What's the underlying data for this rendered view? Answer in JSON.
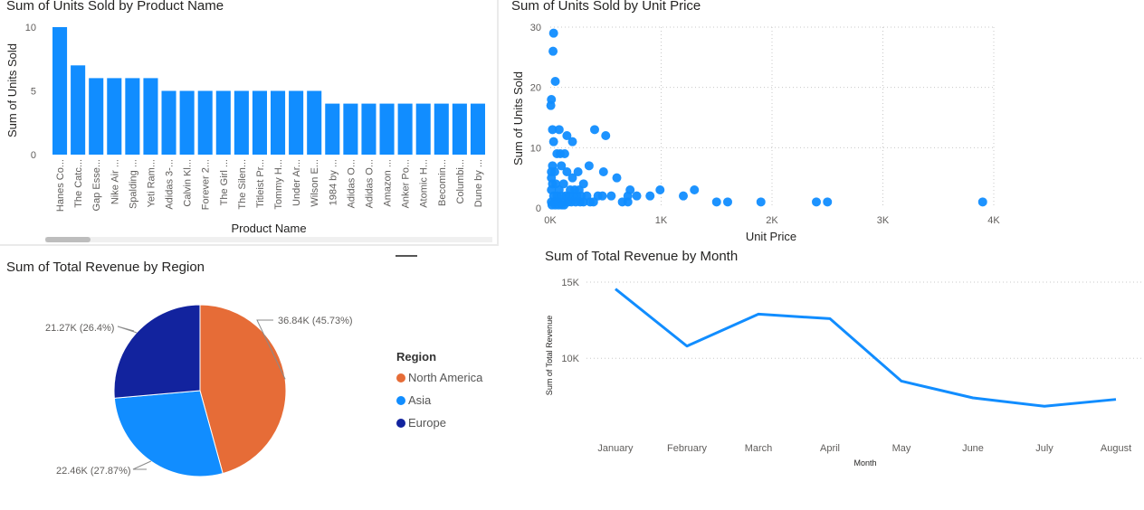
{
  "chart_data": [
    {
      "id": "bar",
      "type": "bar",
      "title": "Sum of Units Sold by Product Name",
      "xlabel": "Product Name",
      "ylabel": "Sum of Units Sold",
      "ylim": [
        0,
        10
      ],
      "yticks": [
        0,
        5,
        10
      ],
      "categories": [
        "Hanes Co...",
        "The Catc...",
        "Gap Esse...",
        "Nike Air ...",
        "Spalding ...",
        "Yeti Ram...",
        "Adidas 3-...",
        "Calvin Kl...",
        "Forever 2...",
        "The Girl ...",
        "The Silen...",
        "Titleist Pr...",
        "Tommy H...",
        "Under Ar...",
        "Wilson E...",
        "1984 by ...",
        "Adidas O...",
        "Adidas O...",
        "Amazon ...",
        "Anker Po...",
        "Atomic H...",
        "Becomin...",
        "Columbi...",
        "Dune by ..."
      ],
      "values": [
        10,
        7,
        6,
        6,
        6,
        6,
        5,
        5,
        5,
        5,
        5,
        5,
        5,
        5,
        5,
        4,
        4,
        4,
        4,
        4,
        4,
        4,
        4,
        4
      ],
      "color": "#118DFF"
    },
    {
      "id": "scatter",
      "type": "scatter",
      "title": "Sum of Units Sold by Unit Price",
      "xlabel": "Unit Price",
      "ylabel": "Sum of Units Sold",
      "xlim": [
        0,
        4000
      ],
      "ylim": [
        0,
        30
      ],
      "xticks": [
        {
          "v": 0,
          "label": "0K"
        },
        {
          "v": 1000,
          "label": "1K"
        },
        {
          "v": 2000,
          "label": "2K"
        },
        {
          "v": 3000,
          "label": "3K"
        },
        {
          "v": 4000,
          "label": "4K"
        }
      ],
      "yticks": [
        0,
        10,
        20,
        30
      ],
      "color": "#118DFF",
      "points": [
        [
          30,
          29
        ],
        [
          25,
          26
        ],
        [
          45,
          21
        ],
        [
          10,
          18
        ],
        [
          5,
          17
        ],
        [
          20,
          13
        ],
        [
          80,
          13
        ],
        [
          150,
          12
        ],
        [
          400,
          13
        ],
        [
          500,
          12
        ],
        [
          30,
          11
        ],
        [
          200,
          11
        ],
        [
          60,
          9
        ],
        [
          90,
          9
        ],
        [
          130,
          9
        ],
        [
          20,
          7
        ],
        [
          100,
          7
        ],
        [
          350,
          7
        ],
        [
          10,
          6
        ],
        [
          40,
          6
        ],
        [
          150,
          6
        ],
        [
          250,
          6
        ],
        [
          480,
          6
        ],
        [
          600,
          5
        ],
        [
          200,
          5
        ],
        [
          300,
          4
        ],
        [
          10,
          5
        ],
        [
          20,
          4
        ],
        [
          50,
          4
        ],
        [
          120,
          4
        ],
        [
          180,
          3
        ],
        [
          220,
          3
        ],
        [
          260,
          3
        ],
        [
          80,
          3
        ],
        [
          10,
          3
        ],
        [
          30,
          2
        ],
        [
          60,
          2
        ],
        [
          100,
          2
        ],
        [
          140,
          2
        ],
        [
          170,
          2
        ],
        [
          210,
          2
        ],
        [
          240,
          2
        ],
        [
          280,
          2
        ],
        [
          330,
          2
        ],
        [
          430,
          2
        ],
        [
          470,
          2
        ],
        [
          550,
          2
        ],
        [
          700,
          2
        ],
        [
          780,
          2
        ],
        [
          900,
          2
        ],
        [
          10,
          1
        ],
        [
          40,
          1
        ],
        [
          70,
          1
        ],
        [
          110,
          1
        ],
        [
          160,
          1
        ],
        [
          190,
          1
        ],
        [
          230,
          1
        ],
        [
          270,
          1
        ],
        [
          300,
          1
        ],
        [
          360,
          1
        ],
        [
          390,
          1
        ],
        [
          650,
          1
        ],
        [
          700,
          1
        ],
        [
          720,
          3
        ],
        [
          990,
          3
        ],
        [
          1300,
          3
        ],
        [
          1200,
          2
        ],
        [
          1500,
          1
        ],
        [
          1600,
          1
        ],
        [
          1900,
          1
        ],
        [
          2400,
          1
        ],
        [
          2500,
          1
        ],
        [
          3900,
          1
        ],
        [
          15,
          0.5
        ],
        [
          45,
          0.5
        ],
        [
          75,
          0.5
        ],
        [
          105,
          0.5
        ],
        [
          125,
          0.5
        ]
      ]
    },
    {
      "id": "pie",
      "type": "pie",
      "title": "Sum of Total Revenue by Region",
      "legend_title": "Region",
      "legend_position": "right",
      "slices": [
        {
          "name": "North America",
          "value": 36840,
          "percent": 45.73,
          "label": "36.84K (45.73%)",
          "color": "#E66C37"
        },
        {
          "name": "Asia",
          "value": 22460,
          "percent": 27.87,
          "label": "22.46K (27.87%)",
          "color": "#118DFF"
        },
        {
          "name": "Europe",
          "value": 21270,
          "percent": 26.4,
          "label": "21.27K (26.4%)",
          "color": "#12239E"
        }
      ]
    },
    {
      "id": "line",
      "type": "line",
      "title": "Sum of Total Revenue by Month",
      "xlabel": "Month",
      "ylabel": "Sum of Total Revenue",
      "categories": [
        "January",
        "February",
        "March",
        "April",
        "May",
        "June",
        "July",
        "August"
      ],
      "values": [
        14550,
        10800,
        12900,
        12600,
        8500,
        7400,
        6850,
        7300
      ],
      "ylim": [
        5500,
        15000
      ],
      "yticks": [
        {
          "v": 10000,
          "label": "10K"
        },
        {
          "v": 15000,
          "label": "15K"
        }
      ],
      "color": "#118DFF"
    }
  ]
}
